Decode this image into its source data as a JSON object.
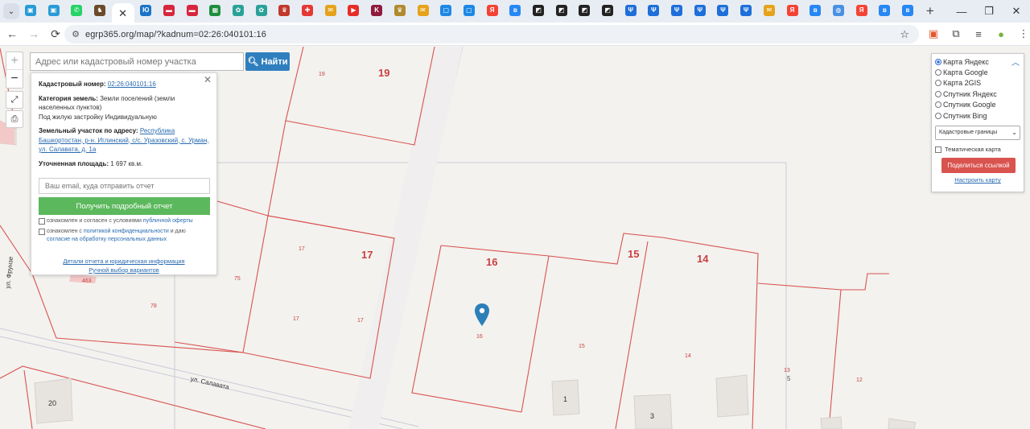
{
  "browser": {
    "tabs": [
      {
        "icon": "tab-dropdown-icon",
        "color": "#d8dfe9"
      },
      {
        "icon": "site-favicon",
        "color": "#2a9bd6"
      },
      {
        "icon": "site-favicon",
        "color": "#2a9bd6"
      },
      {
        "icon": "whatsapp-icon",
        "color": "#25d366"
      },
      {
        "icon": "horse-icon",
        "color": "#6b4a2a"
      },
      {
        "icon": "close-icon",
        "color": "#ffffff",
        "active": true
      },
      {
        "icon": "yumoney-icon",
        "color": "#1a73c7"
      },
      {
        "icon": "card-icon",
        "color": "#d7263d"
      },
      {
        "icon": "card-icon",
        "color": "#d7263d"
      },
      {
        "icon": "sheets-icon",
        "color": "#1e8e3e"
      },
      {
        "icon": "puzzle-icon",
        "color": "#2aa198"
      },
      {
        "icon": "puzzle-icon",
        "color": "#2aa198"
      },
      {
        "icon": "emblem-icon",
        "color": "#c0392b"
      },
      {
        "icon": "plus-red-icon",
        "color": "#e53935"
      },
      {
        "icon": "mail-icon",
        "color": "#e5a21a"
      },
      {
        "icon": "youtube-icon",
        "color": "#e52d27"
      },
      {
        "icon": "k-icon",
        "color": "#8e1b3c"
      },
      {
        "icon": "emblem-icon",
        "color": "#b08a2e"
      },
      {
        "icon": "mail-icon",
        "color": "#e5a21a"
      },
      {
        "icon": "square-blue-icon",
        "color": "#1e88e5"
      },
      {
        "icon": "square-blue-icon",
        "color": "#1e88e5"
      },
      {
        "icon": "yandex-icon",
        "color": "#f44336"
      },
      {
        "icon": "vk-icon",
        "color": "#2787f5"
      },
      {
        "icon": "map-black-icon",
        "color": "#222222"
      },
      {
        "icon": "map-black-icon",
        "color": "#222222"
      },
      {
        "icon": "map-black-icon",
        "color": "#222222"
      },
      {
        "icon": "map-black-icon",
        "color": "#222222"
      },
      {
        "icon": "trident-icon",
        "color": "#1e6fd9"
      },
      {
        "icon": "trident-icon",
        "color": "#1e6fd9"
      },
      {
        "icon": "trident-icon",
        "color": "#1e6fd9"
      },
      {
        "icon": "trident-icon",
        "color": "#1e6fd9"
      },
      {
        "icon": "trident-icon",
        "color": "#1e6fd9"
      },
      {
        "icon": "trident-icon",
        "color": "#1e6fd9"
      },
      {
        "icon": "mail-icon",
        "color": "#e5a21a"
      },
      {
        "icon": "yandex-icon",
        "color": "#f44336"
      },
      {
        "icon": "vk-icon",
        "color": "#2787f5"
      },
      {
        "icon": "globe-icon",
        "color": "#4a90e2"
      },
      {
        "icon": "yandex-icon",
        "color": "#f44336"
      },
      {
        "icon": "vk-icon",
        "color": "#2787f5"
      },
      {
        "icon": "vk-icon",
        "color": "#2787f5"
      }
    ],
    "new_tab": "+",
    "url": "egrp365.org/map/?kadnum=02:26:040101:16"
  },
  "map": {
    "search_placeholder": "Адрес или кадастровый номер участка",
    "search_button": "Найти",
    "zoom_in": "+",
    "zoom_out": "−",
    "popup": {
      "cadastral_label": "Кадастровый номер:",
      "cadastral_value": "02:26:040101:16",
      "category_label": "Категория земель:",
      "category_value": "Земли поселений (земли населенных пунктов)",
      "usage": "Под жилую застройку Индивидуальную",
      "address_label": "Земельный участок по адресу:",
      "address_value": "Республика Башкортостан, р-н. Иглинский, с/с. Уразовский, с. Урман, ул. Салавата, д. 1а",
      "area_label": "Уточненная площадь:",
      "area_value": "1 697 кв.м.",
      "email_placeholder": "Ваш email, куда отправить отчет",
      "report_button": "Получить подробный отчет",
      "agree1_text": "ознакомлен и согласен с условиями",
      "agree1_link": "публичной оферты",
      "agree2_text": "ознакомлен с",
      "agree2_link": "политикой конфиденциальности",
      "agree2_text2": "и даю",
      "agree2_link2": "согласие на обработку персональных данных",
      "link_details": "Детали отчета и юридическая информация",
      "link_manual": "Ручной выбор вариантов"
    },
    "layers": {
      "options": [
        {
          "label": "Карта Яндекс",
          "selected": true
        },
        {
          "label": "Карта Google",
          "selected": false
        },
        {
          "label": "Карта 2GIS",
          "selected": false
        },
        {
          "label": "Спутник Яндекс",
          "selected": false
        },
        {
          "label": "Спутник Google",
          "selected": false
        },
        {
          "label": "Спутник Bing",
          "selected": false
        }
      ],
      "select_value": "Кадастровые границы",
      "thematic_label": "Тематическая карта",
      "share_button": "Поделиться ссылкой",
      "setup_link": "Настроить карту"
    },
    "parcel_labels_big": [
      "19",
      "17",
      "16",
      "15",
      "14"
    ],
    "parcel_labels_small": [
      "19",
      "17",
      "17",
      "17",
      "75",
      "78",
      "16",
      "15",
      "14",
      "13",
      "5",
      "12",
      "463"
    ],
    "streets": [
      "ул. Фрунзе",
      "ул. Салавата"
    ],
    "buildings": [
      "20",
      "1",
      "3"
    ],
    "colors": {
      "parcel_line": "#d9534f",
      "search_blue": "#2f7fbf",
      "report_green": "#5cb85c",
      "share_red": "#d9534f",
      "marker_blue": "#2d7fb8"
    }
  }
}
